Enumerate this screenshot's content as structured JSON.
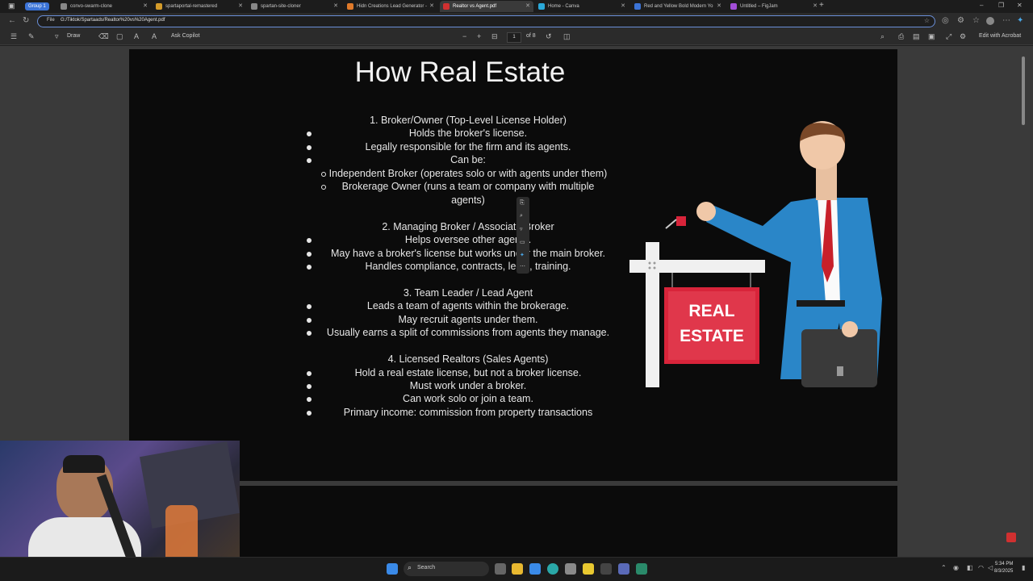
{
  "browser": {
    "group_label": "Group 1",
    "tabs": [
      {
        "label": "convo-swarm-clone",
        "fav": "#888"
      },
      {
        "label": "spartaportal-remastered",
        "fav": "#d49b2a"
      },
      {
        "label": "spartan-site-cloner",
        "fav": "#888"
      },
      {
        "label": "Hidn Creations Lead Generator -",
        "fav": "#e07a2a"
      },
      {
        "label": "Realtor vs Agent.pdf",
        "fav": "#d03030"
      },
      {
        "label": "Home - Canva",
        "fav": "#2aa8d8"
      },
      {
        "label": "Red and Yellow Bold Modern Yo",
        "fav": "#3b73d6"
      },
      {
        "label": "Untitled – FigJam",
        "fav": "#a24ed8"
      }
    ],
    "active_tab_index": 4,
    "address_prefix": "File",
    "url": "G:/Tiktok/Spartaads/Realtor%20vs%20Agent.pdf"
  },
  "pdf_toolbar": {
    "draw_label": "Draw",
    "copilot_label": "Ask Copilot",
    "page_current": "1",
    "page_total": "of 8",
    "edit_label": "Edit with Acrobat"
  },
  "slide": {
    "title": "How Real Estate",
    "lines": [
      {
        "text": "1. Broker/Owner (Top-Level License Holder)",
        "bullet": "none"
      },
      {
        "text": "Holds the broker's license.",
        "bullet": "disc"
      },
      {
        "text": "Legally responsible for the firm and its agents.",
        "bullet": "disc"
      },
      {
        "text": "Can be:",
        "bullet": "disc"
      },
      {
        "text": "Independent Broker (operates solo or with agents under them)",
        "bullet": "circle"
      },
      {
        "text": "Brokerage Owner (runs a team or company with multiple",
        "bullet": "circle"
      },
      {
        "text": "agents)",
        "bullet": "none"
      },
      {
        "text": "",
        "bullet": "none"
      },
      {
        "text": "2. Managing Broker / Associate Broker",
        "bullet": "none"
      },
      {
        "text": "Helps oversee other agents.",
        "bullet": "disc"
      },
      {
        "text": "May have a broker's license but works under the main broker.",
        "bullet": "disc"
      },
      {
        "text": "Handles compliance, contracts, legal, training.",
        "bullet": "disc"
      },
      {
        "text": "",
        "bullet": "none"
      },
      {
        "text": "3. Team Leader / Lead Agent",
        "bullet": "none"
      },
      {
        "text": "Leads a team of agents within the brokerage.",
        "bullet": "disc"
      },
      {
        "text": "May recruit agents under them.",
        "bullet": "disc"
      },
      {
        "text": "Usually earns a split of commissions from agents they manage.",
        "bullet": "disc"
      },
      {
        "text": "",
        "bullet": "none"
      },
      {
        "text": "4. Licensed Realtors (Sales Agents)",
        "bullet": "none"
      },
      {
        "text": "Hold a real estate license, but not a broker license.",
        "bullet": "disc"
      },
      {
        "text": "Must work under a broker.",
        "bullet": "disc"
      },
      {
        "text": "Can work solo or join a team.",
        "bullet": "disc"
      },
      {
        "text": "Primary income: commission from property transactions",
        "bullet": "disc"
      }
    ],
    "sign_line1": "REAL",
    "sign_line2": "ESTATE"
  },
  "taskbar": {
    "search_label": "Search",
    "time": "5:34 PM",
    "date": "8/3/2025"
  },
  "colors": {
    "accent": "#3b73d6",
    "sign_red": "#d8243a",
    "suit_blue": "#2a86c8",
    "tie_red": "#c8202a"
  }
}
